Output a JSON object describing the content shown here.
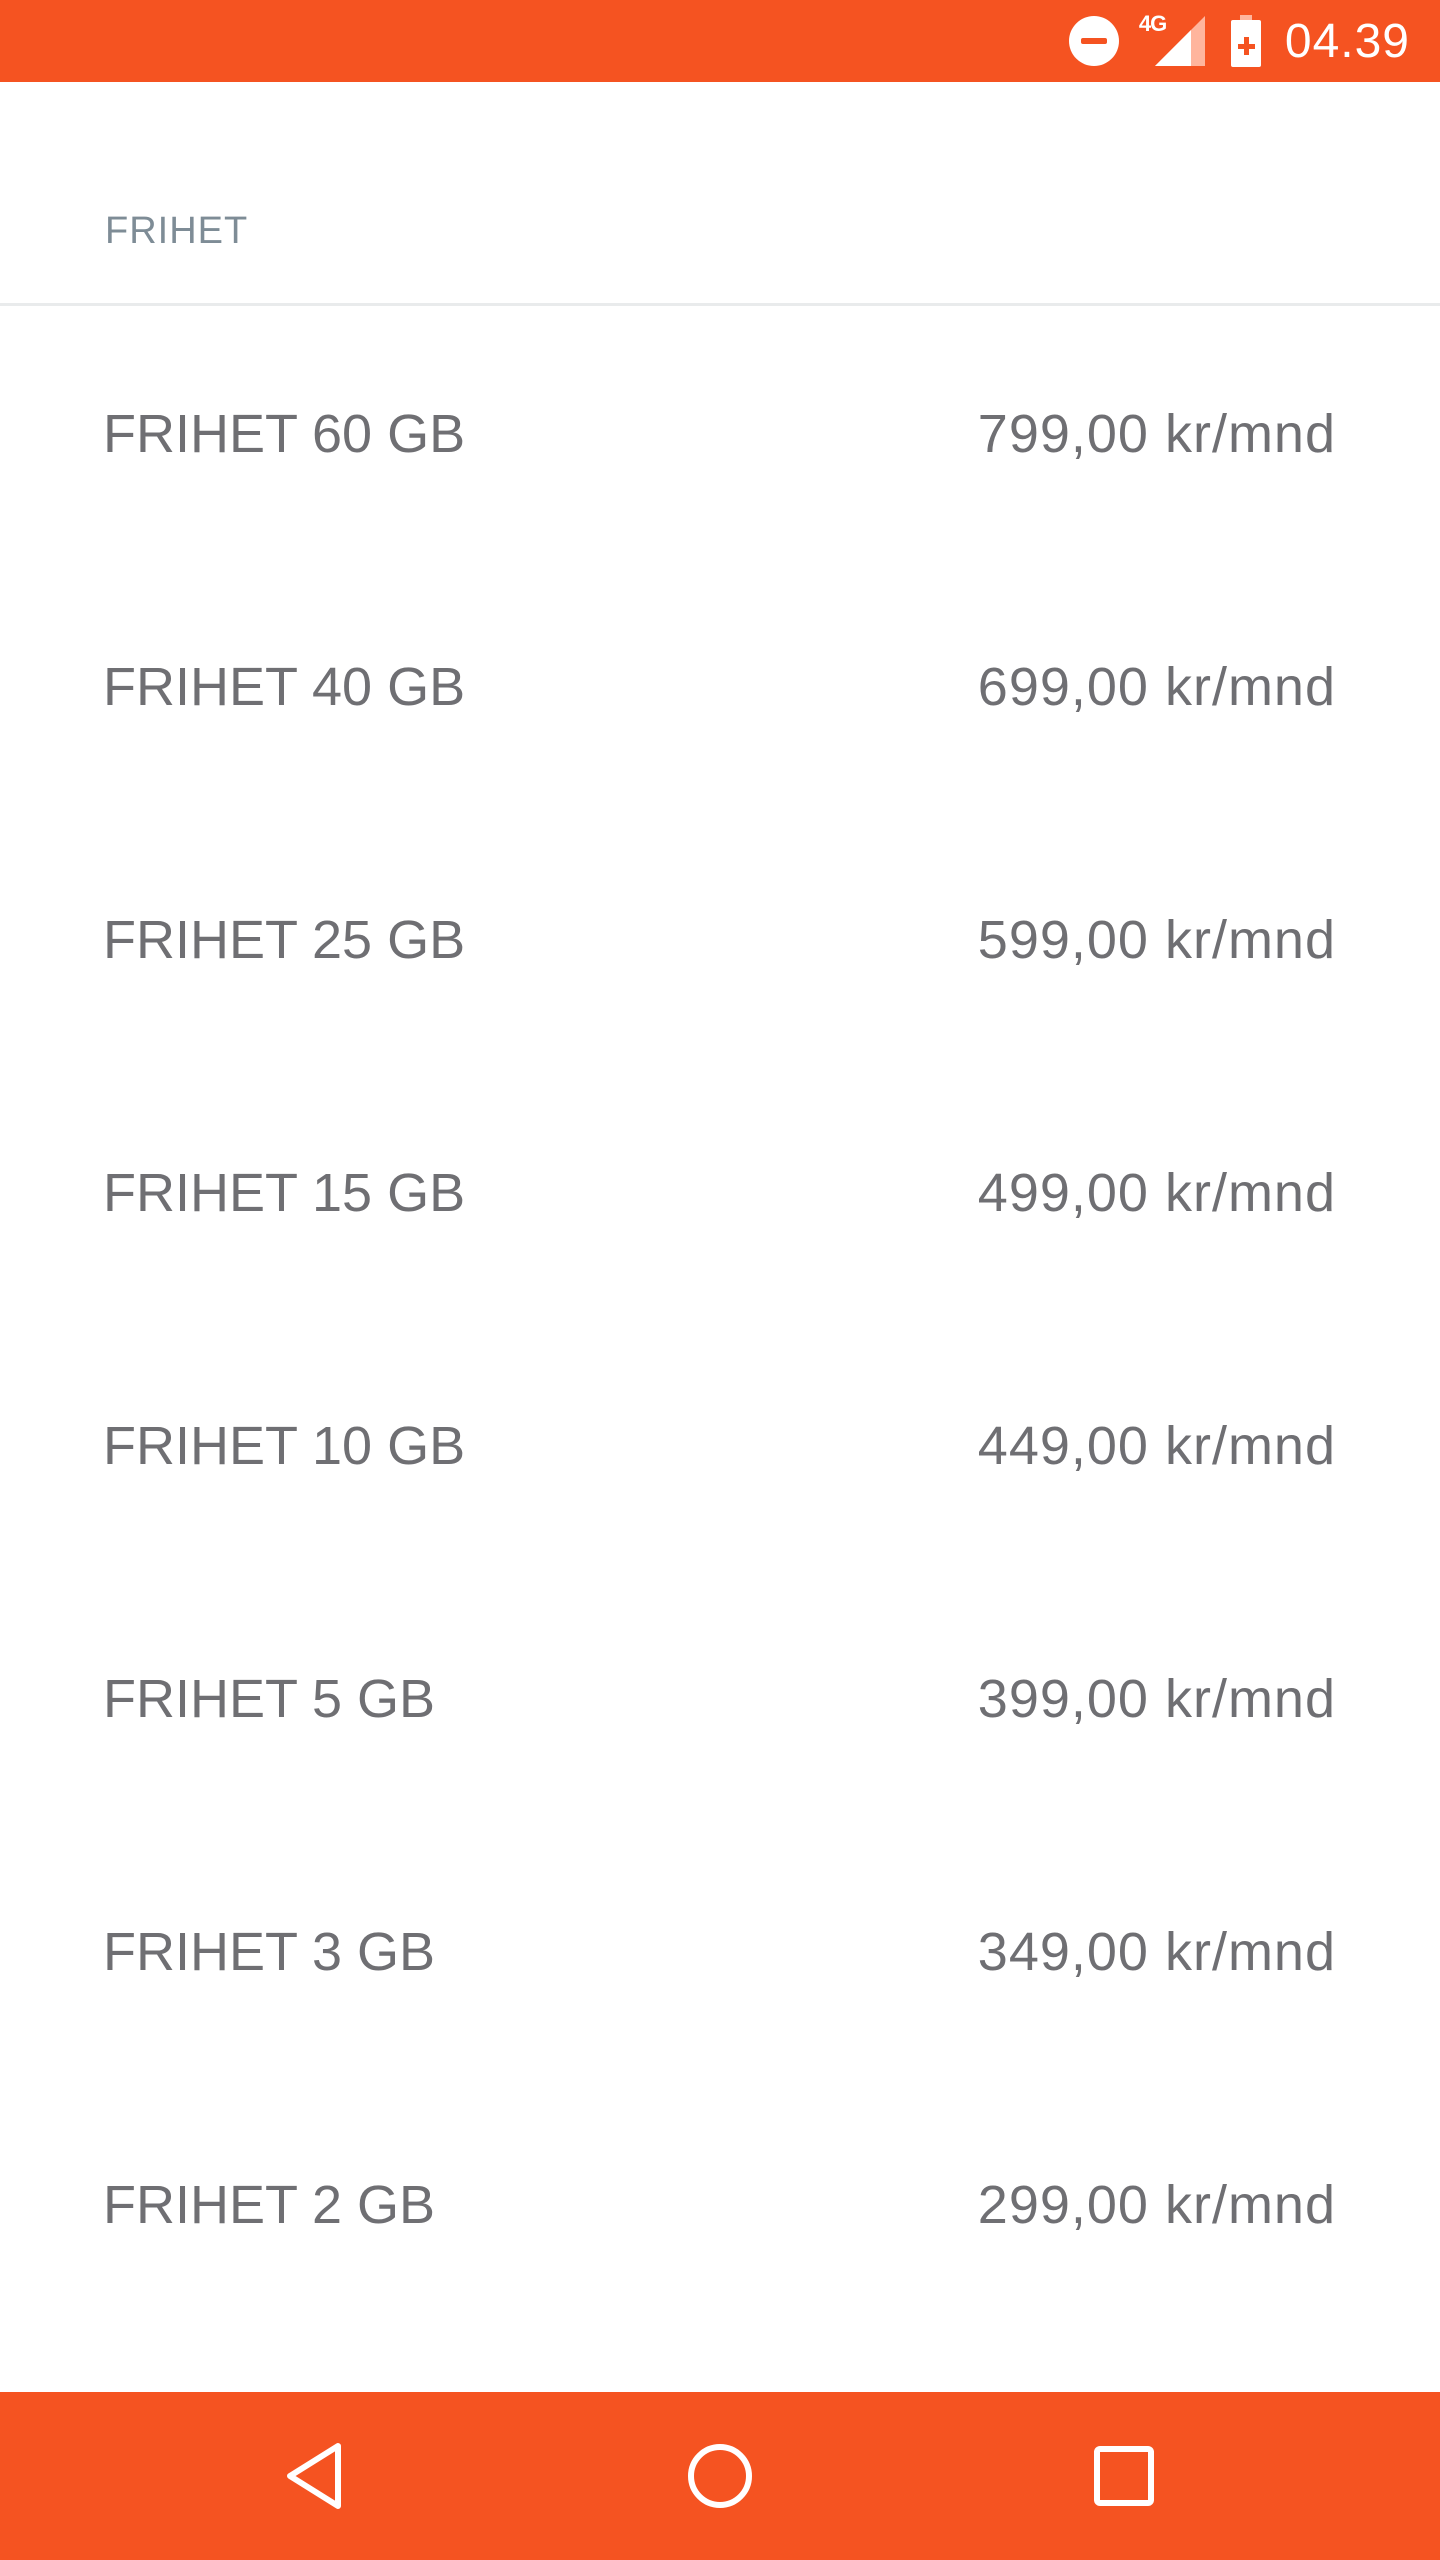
{
  "status_bar": {
    "network_type": "4G",
    "time": "04.39",
    "icons": [
      "do-not-disturb-icon",
      "cellular-signal-icon",
      "battery-charging-icon"
    ]
  },
  "header": {
    "title": "FRIHET"
  },
  "plans": [
    {
      "name": "FRIHET 60 GB",
      "price": "799,00 kr/mnd"
    },
    {
      "name": "FRIHET 40 GB",
      "price": "699,00 kr/mnd"
    },
    {
      "name": "FRIHET 25 GB",
      "price": "599,00 kr/mnd"
    },
    {
      "name": "FRIHET 15 GB",
      "price": "499,00 kr/mnd"
    },
    {
      "name": "FRIHET 10 GB",
      "price": "449,00 kr/mnd"
    },
    {
      "name": "FRIHET 5 GB",
      "price": "399,00 kr/mnd"
    },
    {
      "name": "FRIHET 3 GB",
      "price": "349,00 kr/mnd"
    },
    {
      "name": "FRIHET 2 GB",
      "price": "299,00 kr/mnd"
    }
  ],
  "nav_bar": {
    "icons": [
      "back-icon",
      "home-icon",
      "recents-icon"
    ]
  },
  "colors": {
    "accent": "#f55321",
    "header_text": "#7e8c96",
    "row_text": "#6f6f73",
    "divider": "#e9ebec"
  }
}
